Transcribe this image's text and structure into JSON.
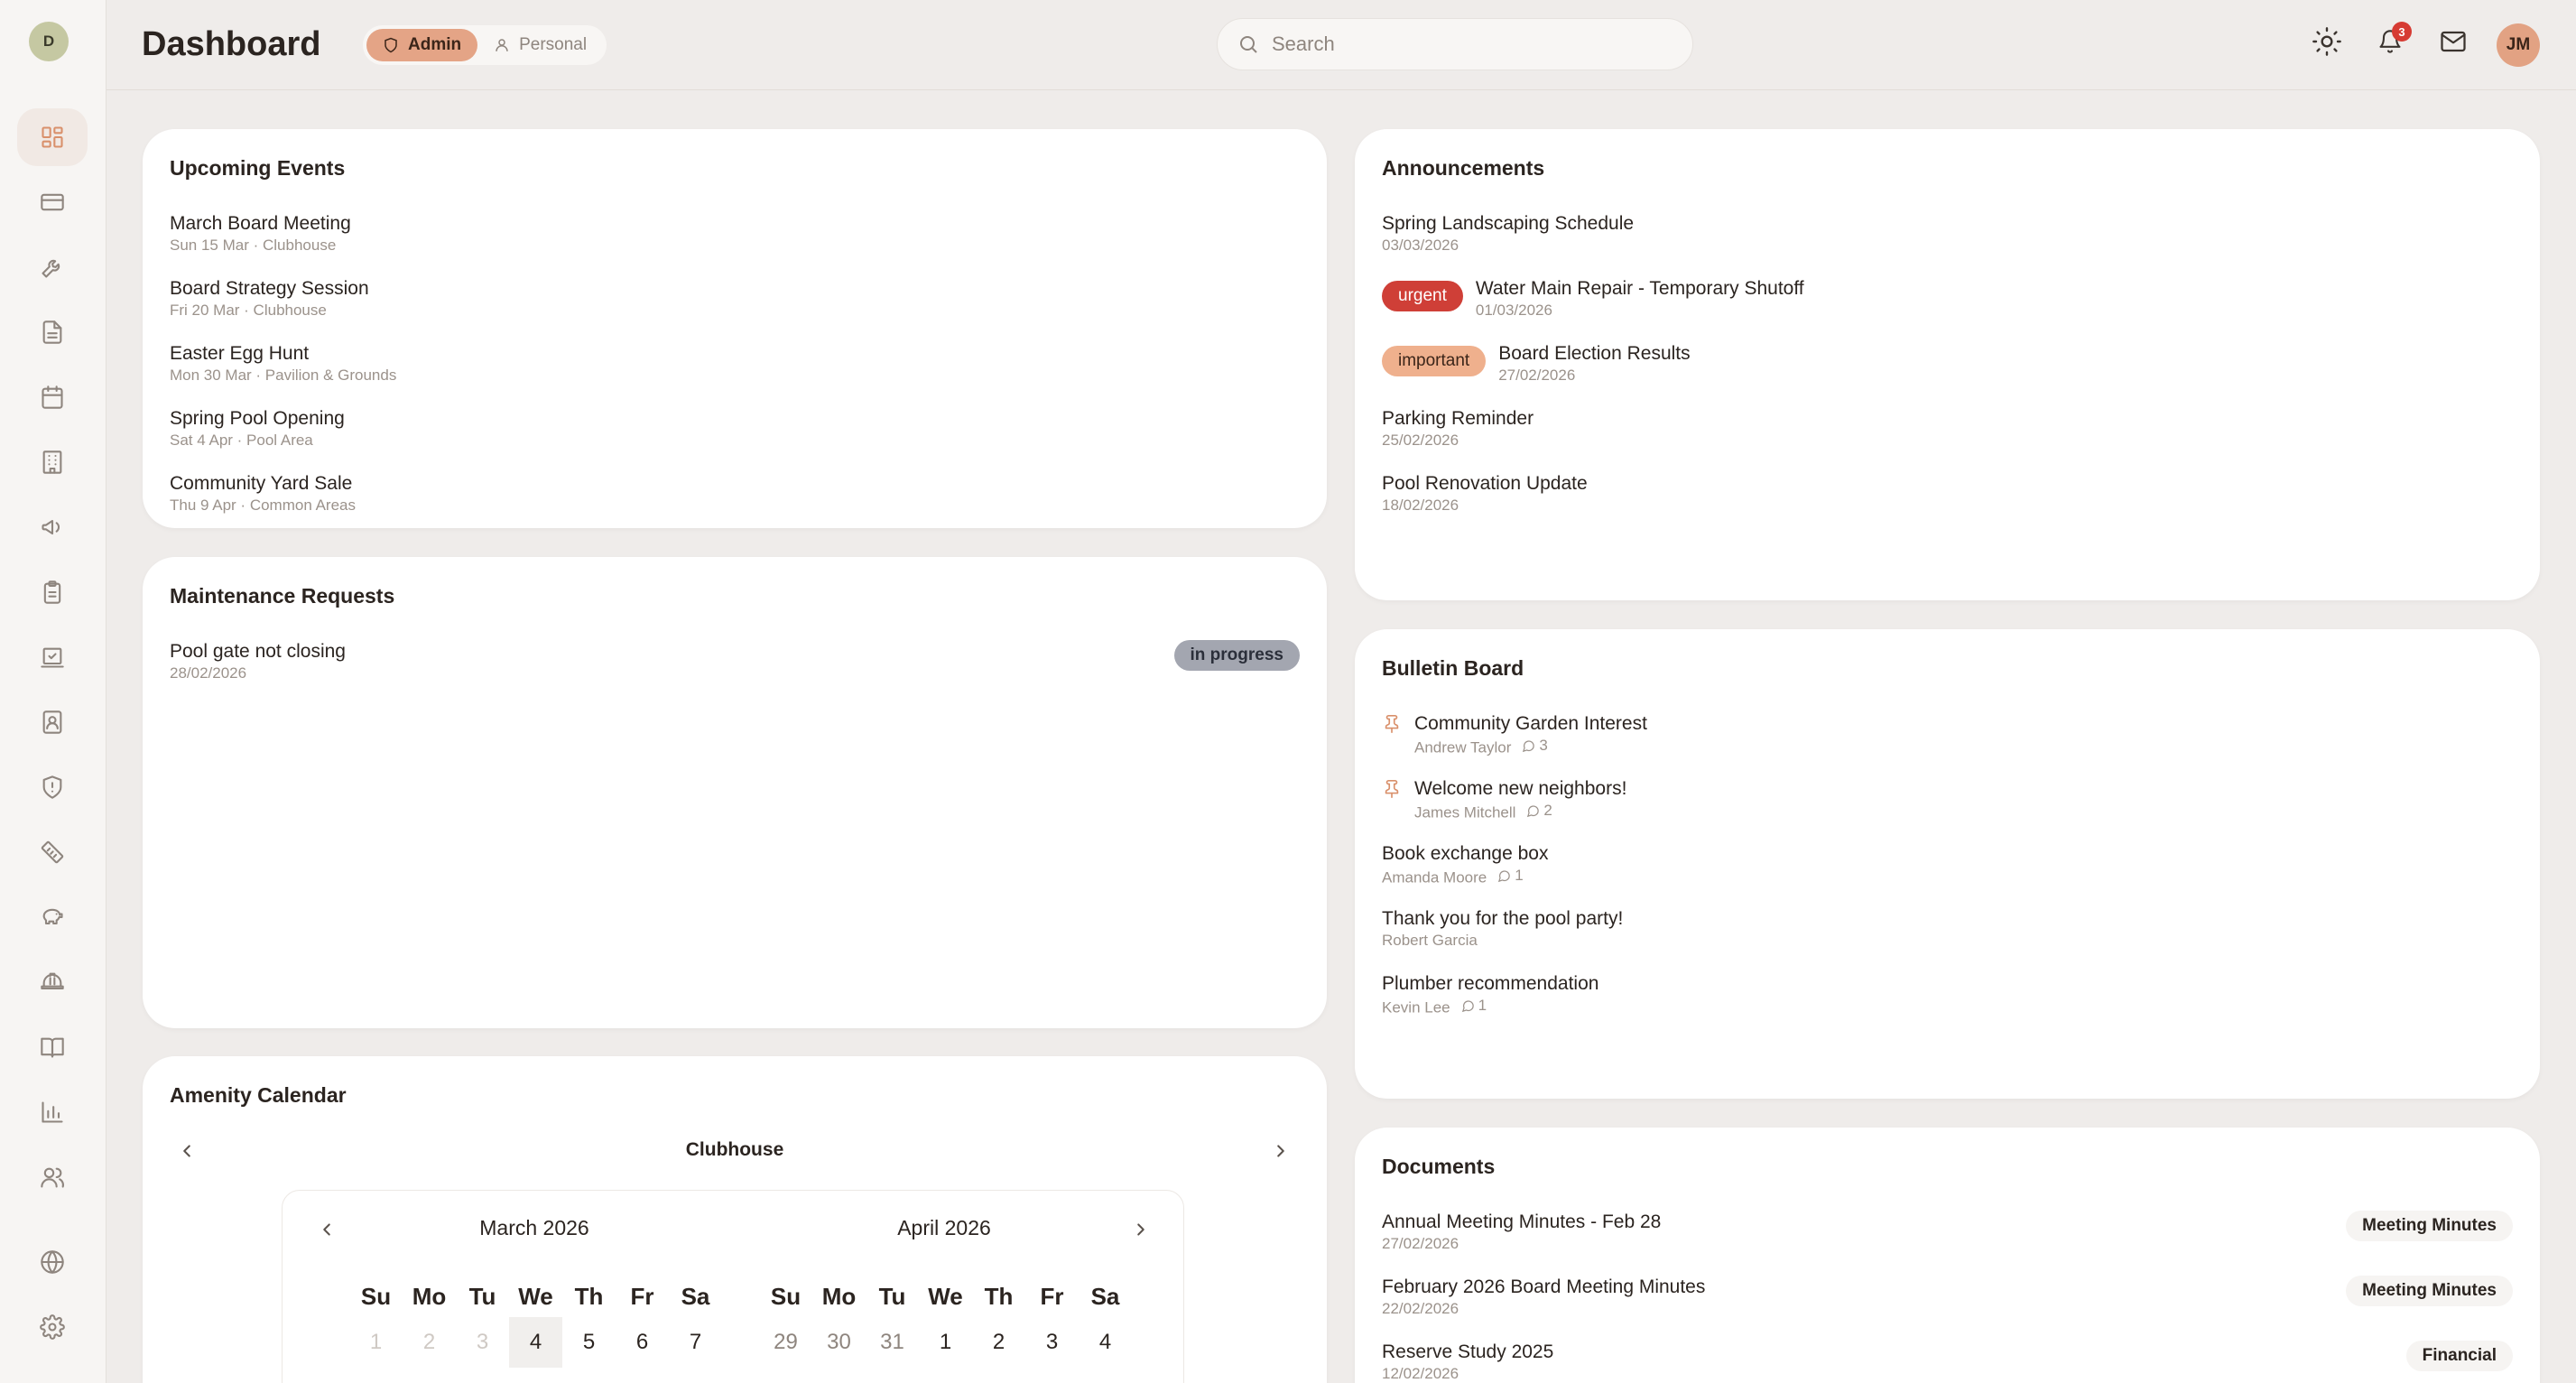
{
  "sidebar": {
    "logo": "D",
    "items": [
      {
        "icon": "dashboard-icon"
      },
      {
        "icon": "credit-card-icon"
      },
      {
        "icon": "wrench-icon"
      },
      {
        "icon": "document-icon"
      },
      {
        "icon": "calendar-icon"
      },
      {
        "icon": "building-icon"
      },
      {
        "icon": "megaphone-icon"
      },
      {
        "icon": "clipboard-icon"
      },
      {
        "icon": "vote-icon"
      },
      {
        "icon": "contact-icon"
      },
      {
        "icon": "shield-icon"
      },
      {
        "icon": "ruler-icon"
      },
      {
        "icon": "piggy-bank-icon"
      },
      {
        "icon": "hard-hat-icon"
      },
      {
        "icon": "book-icon"
      },
      {
        "icon": "bar-chart-icon"
      },
      {
        "icon": "users-icon"
      },
      {
        "icon": "globe-icon"
      },
      {
        "icon": "settings-icon"
      }
    ]
  },
  "header": {
    "title": "Dashboard",
    "roles": {
      "admin": "Admin",
      "personal": "Personal"
    },
    "search_placeholder": "Search",
    "notification_count": "3",
    "avatar": "JM"
  },
  "events": {
    "title": "Upcoming Events",
    "items": [
      {
        "title": "March Board Meeting",
        "sub": "Sun 15 Mar · Clubhouse"
      },
      {
        "title": "Board Strategy Session",
        "sub": "Fri 20 Mar · Clubhouse"
      },
      {
        "title": "Easter Egg Hunt",
        "sub": "Mon 30 Mar · Pavilion & Grounds"
      },
      {
        "title": "Spring Pool Opening",
        "sub": "Sat 4 Apr · Pool Area"
      },
      {
        "title": "Community Yard Sale",
        "sub": "Thu 9 Apr · Common Areas"
      }
    ]
  },
  "announcements": {
    "title": "Announcements",
    "items": [
      {
        "title": "Spring Landscaping Schedule",
        "date": "03/03/2026",
        "badge": ""
      },
      {
        "title": "Water Main Repair - Temporary Shutoff",
        "date": "01/03/2026",
        "badge": "urgent"
      },
      {
        "title": "Board Election Results",
        "date": "27/02/2026",
        "badge": "important"
      },
      {
        "title": "Parking Reminder",
        "date": "25/02/2026",
        "badge": ""
      },
      {
        "title": "Pool Renovation Update",
        "date": "18/02/2026",
        "badge": ""
      }
    ]
  },
  "maintenance": {
    "title": "Maintenance Requests",
    "items": [
      {
        "title": "Pool gate not closing",
        "date": "28/02/2026",
        "status": "in progress"
      }
    ]
  },
  "bulletin": {
    "title": "Bulletin Board",
    "items": [
      {
        "title": "Community Garden Interest",
        "author": "Andrew Taylor",
        "comments": "3",
        "pinned": true
      },
      {
        "title": "Welcome new neighbors!",
        "author": "James Mitchell",
        "comments": "2",
        "pinned": true
      },
      {
        "title": "Book exchange box",
        "author": "Amanda Moore",
        "comments": "1",
        "pinned": false
      },
      {
        "title": "Thank you for the pool party!",
        "author": "Robert Garcia",
        "comments": "",
        "pinned": false
      },
      {
        "title": "Plumber recommendation",
        "author": "Kevin Lee",
        "comments": "1",
        "pinned": false
      }
    ]
  },
  "calendar": {
    "title": "Amenity Calendar",
    "amenity": "Clubhouse",
    "weekdays": [
      "Su",
      "Mo",
      "Tu",
      "We",
      "Th",
      "Fr",
      "Sa"
    ],
    "months": [
      {
        "name": "March 2026",
        "days": [
          "1",
          "2",
          "3",
          "4",
          "5",
          "6",
          "7"
        ]
      },
      {
        "name": "April 2026",
        "days": [
          "29",
          "30",
          "31",
          "1",
          "2",
          "3",
          "4"
        ]
      }
    ]
  },
  "documents": {
    "title": "Documents",
    "items": [
      {
        "title": "Annual Meeting Minutes - Feb 28",
        "date": "27/02/2026",
        "tag": "Meeting Minutes"
      },
      {
        "title": "February 2026 Board Meeting Minutes",
        "date": "22/02/2026",
        "tag": "Meeting Minutes"
      },
      {
        "title": "Reserve Study 2025",
        "date": "12/02/2026",
        "tag": "Financial"
      }
    ]
  },
  "colors": {
    "accent": "#e4a486",
    "urgent": "#cf3f37",
    "important": "#efb08d",
    "status_in_progress": "#a3a6b0"
  }
}
